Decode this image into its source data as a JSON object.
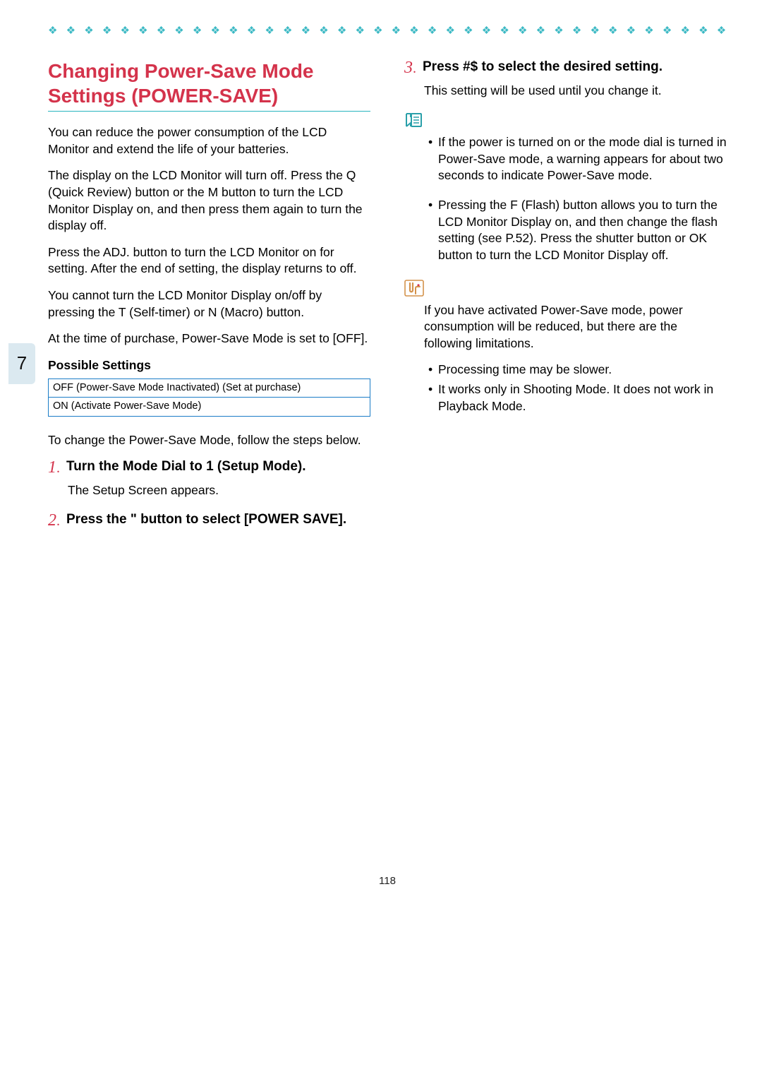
{
  "tab_number": "7",
  "page_number": "118",
  "diamond_row": "❖ ❖ ❖ ❖ ❖ ❖ ❖ ❖ ❖ ❖ ❖ ❖ ❖ ❖ ❖ ❖ ❖ ❖ ❖ ❖ ❖ ❖ ❖ ❖ ❖ ❖ ❖ ❖ ❖ ❖ ❖ ❖ ❖ ❖ ❖ ❖ ❖ ❖ ❖ ❖ ❖ ❖ ❖ ❖ ❖ ❖ ❖ ❖ ❖ ❖ ❖ ❖ ❖ ❖ ❖ ❖",
  "title": "Changing Power-Save Mode Settings (POWER-SAVE)",
  "left": {
    "p1": "You can reduce the power consumption of the LCD Monitor and extend the life of your batteries.",
    "p2": "The display on the LCD Monitor will turn off. Press the Q  (Quick Review) button or the M        button to turn the LCD Monitor Display on, and then press them again to turn the display off.",
    "p3": "Press the ADJ. button to turn the LCD Monitor on for setting. After the end of setting, the display returns to off.",
    "p4": "You cannot turn the LCD Monitor Display on/off by pressing the T  (Self-timer) or N (Macro) button.",
    "p5": "At the time of purchase, Power-Save Mode is set to [OFF].",
    "possible_heading": "Possible Settings",
    "table": {
      "row1": "OFF (Power-Save Mode Inactivated) (Set at purchase)",
      "row2": "ON (Activate Power-Save Mode)"
    },
    "p6": "To change the Power-Save Mode, follow the steps below.",
    "step1_num": "1",
    "step1_title": "Turn the Mode Dial to 1 (Setup Mode).",
    "step1_body": "The Setup Screen appears.",
    "step2_num": "2",
    "step2_title": "Press the \"   button to select [POWER SAVE]."
  },
  "right": {
    "step3_num": "3",
    "step3_title": "Press #$   to select the desired setting.",
    "step3_body": "This setting will be used until you change it.",
    "note_b1": "If the power is turned on or the mode dial is turned in Power-Save mode, a warning appears for about two seconds to indicate Power-Save mode.",
    "note_b2": "Pressing the F (Flash) button allows you to turn the LCD Monitor Display on, and then change the flash setting (see P.52). Press the shutter button or OK button to turn the LCD Monitor Display off.",
    "hint_p": "If you have activated Power-Save mode, power consumption will be reduced, but there are the following limitations.",
    "hint_b1": "Processing time may be slower.",
    "hint_b2": "It works only in Shooting Mode. It does not work in Playback Mode."
  }
}
